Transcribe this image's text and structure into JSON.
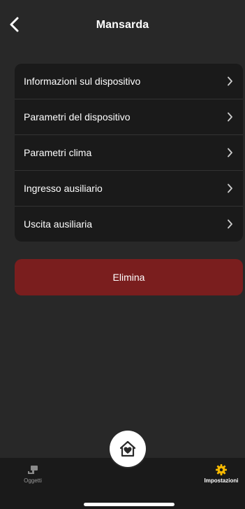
{
  "header": {
    "title": "Mansarda",
    "back_icon": "chevron-left-icon"
  },
  "menu": {
    "items": [
      {
        "label": "Informazioni sul dispositivo"
      },
      {
        "label": "Parametri del dispositivo"
      },
      {
        "label": "Parametri clima"
      },
      {
        "label": "Ingresso ausiliario"
      },
      {
        "label": "Uscita ausiliaria"
      }
    ]
  },
  "delete_button": {
    "label": "Elimina",
    "color": "#7a1e1e"
  },
  "fab": {
    "icon": "home-heart-icon"
  },
  "bottom_nav": {
    "items": [
      {
        "label": "Oggetti",
        "icon": "camera-icon",
        "active": false
      },
      {
        "label": "Impostazioni",
        "icon": "gear-icon",
        "active": true,
        "color": "#f5b800"
      }
    ]
  },
  "colors": {
    "background": "#282828",
    "card": "#1a1a1a",
    "accent": "#f5b800"
  }
}
